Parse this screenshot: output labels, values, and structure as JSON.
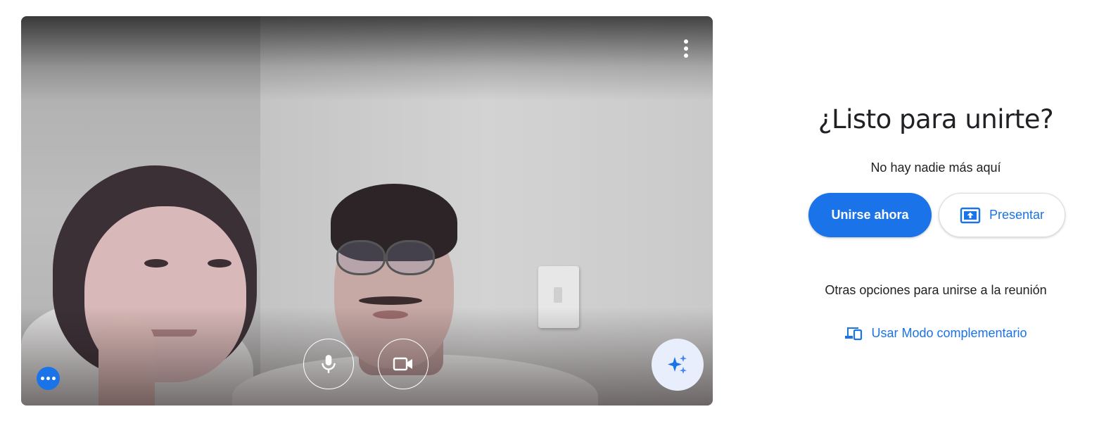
{
  "preview": {
    "menu_icon": "more-vert-icon",
    "mic_icon": "microphone-icon",
    "camera_icon": "videocam-icon",
    "effects_icon": "sparkle-icon",
    "options_icon": "more-horiz-icon"
  },
  "panel": {
    "title": "¿Listo para unirte?",
    "subtitle": "No hay nadie más aquí",
    "join_label": "Unirse ahora",
    "present_label": "Presentar",
    "present_icon": "present-to-all-icon",
    "other_options": "Otras opciones para unirse a la reunión",
    "companion_label": "Usar Modo complementario",
    "companion_icon": "devices-icon"
  },
  "colors": {
    "accent": "#1a73e8",
    "text": "#202124",
    "effects_bg": "#e8eefc"
  }
}
